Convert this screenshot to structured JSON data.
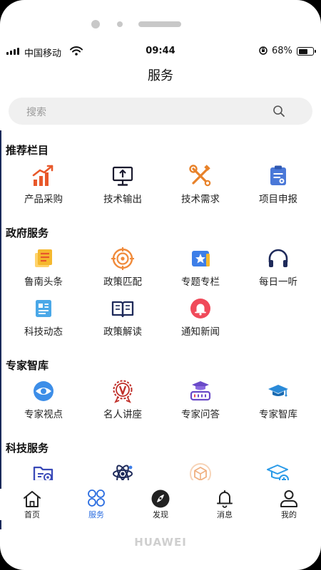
{
  "status": {
    "carrier": "中国移动",
    "time": "09:44",
    "battery_pct": "68%",
    "battery_level": 0.68
  },
  "header": {
    "title": "服务"
  },
  "search": {
    "placeholder": "搜索"
  },
  "sections": [
    {
      "title": "推荐栏目",
      "items": [
        {
          "label": "产品采购",
          "icon": "rising-bar-chart-icon",
          "color": "#e8582a"
        },
        {
          "label": "技术输出",
          "icon": "monitor-upload-icon",
          "color": "#1a1a2e"
        },
        {
          "label": "技术需求",
          "icon": "tools-icon",
          "color": "#e8822a"
        },
        {
          "label": "项目申报",
          "icon": "document-clip-icon",
          "color": "#4a78d8"
        }
      ]
    },
    {
      "title": "政府服务",
      "items": [
        {
          "label": "鲁南头条",
          "icon": "news-card-icon",
          "color": "#f5b82e"
        },
        {
          "label": "政策匹配",
          "icon": "target-icon",
          "color": "#f08a3a"
        },
        {
          "label": "专题专栏",
          "icon": "star-bookmark-icon",
          "color": "#3d7ee8"
        },
        {
          "label": "每日一听",
          "icon": "headphones-icon",
          "color": "#1e2a5a"
        },
        {
          "label": "科技动态",
          "icon": "bulletin-icon",
          "color": "#4aa8e8"
        },
        {
          "label": "政策解读",
          "icon": "open-book-icon",
          "color": "#1e2a5a"
        },
        {
          "label": "通知新闻",
          "icon": "notification-bell-icon",
          "color": "#f04a5a"
        }
      ]
    },
    {
      "title": "专家智库",
      "items": [
        {
          "label": "专家视点",
          "icon": "eye-icon",
          "color": "#3d8ee8"
        },
        {
          "label": "名人讲座",
          "icon": "laurel-badge-icon",
          "color": "#c0302a"
        },
        {
          "label": "专家问答",
          "icon": "graduate-bar-icon",
          "color": "#6a4ac8"
        },
        {
          "label": "专家智库",
          "icon": "mortarboard-icon",
          "color": "#2a8ad8"
        }
      ]
    },
    {
      "title": "科技服务",
      "items": [
        {
          "label": "",
          "icon": "folder-gear-icon",
          "color": "#3a4ab8"
        },
        {
          "label": "",
          "icon": "atom-icon",
          "color": "#1e2a5a"
        },
        {
          "label": "",
          "icon": "package-icon",
          "color": "#f0b080"
        },
        {
          "label": "",
          "icon": "graduation-plus-icon",
          "color": "#2a9ae8"
        }
      ]
    }
  ],
  "tabbar": [
    {
      "label": "首页",
      "icon": "home-icon",
      "active": false
    },
    {
      "label": "服务",
      "icon": "clover-grid-icon",
      "active": true
    },
    {
      "label": "发现",
      "icon": "compass-icon",
      "active": false
    },
    {
      "label": "消息",
      "icon": "bell-icon",
      "active": false
    },
    {
      "label": "我的",
      "icon": "user-icon",
      "active": false
    }
  ],
  "device": {
    "brand": "HUAWEI"
  }
}
